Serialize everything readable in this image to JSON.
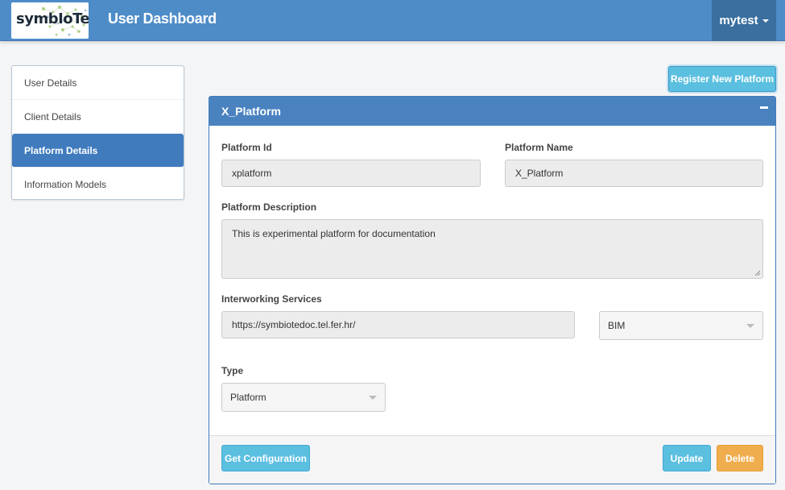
{
  "header": {
    "logo_text": "symbIoTe",
    "title": "User Dashboard",
    "user_menu": "mytest"
  },
  "sidebar": {
    "items": [
      {
        "label": "User Details",
        "active": false
      },
      {
        "label": "Client Details",
        "active": false
      },
      {
        "label": "Platform Details",
        "active": true
      },
      {
        "label": "Information Models",
        "active": false
      }
    ]
  },
  "actions": {
    "register_label": "Register New Platform"
  },
  "panel": {
    "title": "X_Platform",
    "platform_id_label": "Platform Id",
    "platform_id_value": "xplatform",
    "platform_name_label": "Platform Name",
    "platform_name_value": "X_Platform",
    "description_label": "Platform Description",
    "description_value": "This is experimental platform for documentation",
    "interworking_label": "Interworking Services",
    "interworking_url": "https://symbiotedoc.tel.fer.hr/",
    "interworking_model": "BIM",
    "type_label": "Type",
    "type_value": "Platform",
    "footer": {
      "get_config_label": "Get Configuration",
      "update_label": "Update",
      "delete_label": "Delete"
    }
  },
  "colors": {
    "navbar": "#4e8cc8",
    "user_menu_bg": "#3a6f9f",
    "active_item": "#3f7bbd",
    "panel_heading": "#4a82c0",
    "info_button": "#5bbfe0",
    "warning_button": "#f0ad4e"
  }
}
